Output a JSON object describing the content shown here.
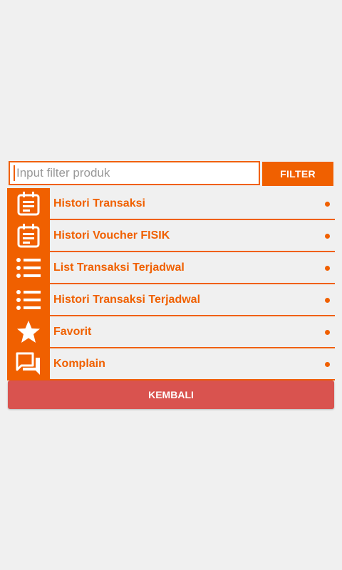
{
  "filter": {
    "placeholder": "Input filter produk",
    "value": "",
    "button_label": "FILTER"
  },
  "menu": {
    "items": [
      {
        "label": "Histori Transaksi",
        "icon": "calendar-note-icon"
      },
      {
        "label": "Histori Voucher FISIK",
        "icon": "calendar-note-icon"
      },
      {
        "label": "List Transaksi Terjadwal",
        "icon": "list-icon"
      },
      {
        "label": "Histori Transaksi Terjadwal",
        "icon": "list-icon"
      },
      {
        "label": "Favorit",
        "icon": "star-icon"
      },
      {
        "label": "Komplain",
        "icon": "chat-icon"
      }
    ]
  },
  "back_button_label": "KEMBALI",
  "colors": {
    "accent": "#f06000",
    "back_button": "#d9534f",
    "background": "#f0f0f0"
  }
}
